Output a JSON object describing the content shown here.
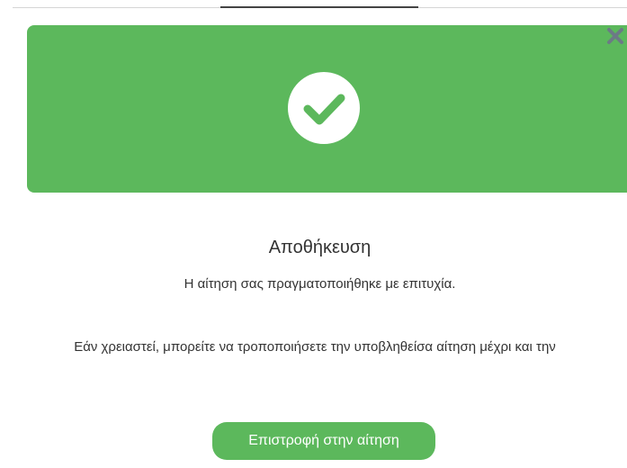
{
  "modal": {
    "close_icon": "close-icon",
    "success_icon": "check-circle-icon",
    "title": "Αποθήκευση",
    "message": "Η αίτηση σας πραγματοποιήθηκε με επιτυχία.",
    "info_text": "Εάν χρειαστεί, μπορείτε να τροποποιήσετε την υποβληθείσα αίτηση μέχρι και την",
    "return_button_label": "Επιστροφή στην αίτηση"
  },
  "colors": {
    "success_green": "#5cb85c",
    "close_icon_color": "#6c7a86",
    "text": "#333333"
  }
}
